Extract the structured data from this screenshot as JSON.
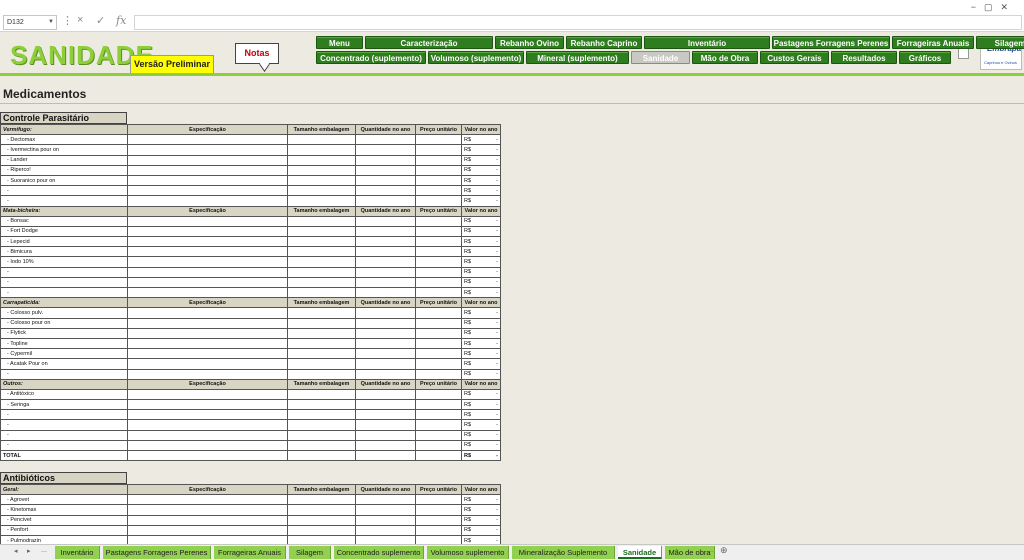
{
  "formula_bar": {
    "name_box": "D132",
    "cancel_icon": "×",
    "enter_icon": "✓",
    "fx_label": "fx",
    "formula": ""
  },
  "header": {
    "logo": "SANIDADE",
    "version": "Versão Preliminar",
    "notes": "Notas",
    "embrapa_name": "Embrapa",
    "embrapa_sub": "Caprinos e Ovinos"
  },
  "nav": {
    "row1": [
      "Menu",
      "Caracterização",
      "Rebanho Ovino",
      "Rebanho Caprino",
      "Inventário",
      "Pastagens Forragens Perenes",
      "Forrageiras Anuais",
      "Silagem"
    ],
    "row2": [
      "Concentrado (suplemento)",
      "Volumoso (suplemento)",
      "Mineral (suplemento)",
      "Sanidade",
      "Mão de Obra",
      "Custos Gerais",
      "Resultados",
      "Gráficos"
    ],
    "active": "Sanidade"
  },
  "page_title": "Medicamentos",
  "columns": [
    "Especificação",
    "Tamanho embalagem",
    "Quantidade no ano",
    "Preço unitário",
    "Valor no ano"
  ],
  "currency": "R$",
  "dash": "-",
  "parasitario": {
    "title": "Controle Parasitário",
    "groups": [
      {
        "name": "Vermífugo:",
        "items": [
          "- Dectomax",
          "- Ivermectina pour on",
          "- Lander",
          "- Riperco!",
          "- Suoranico pour on",
          "-",
          "-"
        ]
      },
      {
        "name": "Mata-bicheira:",
        "items": [
          "- Bonsac",
          "- Fort Dodge",
          "- Lepecid",
          "- Bimicura",
          "- Iodo 10%",
          "-",
          "-",
          "-"
        ]
      },
      {
        "name": "Carrapaticida:",
        "items": [
          "- Colosso pulv.",
          "- Colosso pour on",
          "- Flytick",
          "- Topline",
          "- Cypermil",
          "- Acatak Pour on",
          "-"
        ]
      },
      {
        "name": "Outros:",
        "items": [
          "- Antitóxico",
          "- Seringa",
          "-",
          "-",
          "-",
          "-"
        ]
      }
    ],
    "total_label": "TOTAL"
  },
  "antibioticos": {
    "title": "Antibióticos",
    "groups": [
      {
        "name": "Geral:",
        "items": [
          "- Agrovet",
          "- Kinetomax",
          "- Pencivet",
          "- Penfort",
          "- Pulmodrazin"
        ]
      }
    ]
  },
  "sheet_tabs": [
    "Inventário",
    "Pastagens Forragens Perenes",
    "Forrageiras Anuais",
    "Silagem",
    "Concentrado suplemento",
    "Volumoso suplemento",
    "Mineralização Suplemento",
    "Sanidade",
    "Mão de obra"
  ],
  "tab_nav": {
    "prev": "◂",
    "next": "▸",
    "more": "...",
    "add": "⊕"
  }
}
